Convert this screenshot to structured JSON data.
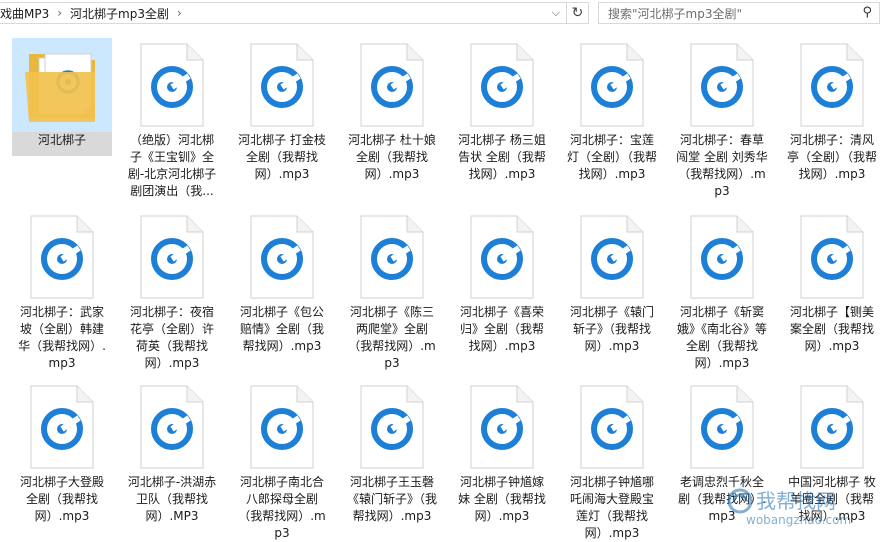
{
  "address_bar": {
    "segments": [
      "戏曲MP3",
      "河北梆子mp3全剧"
    ],
    "separator": "›"
  },
  "search": {
    "placeholder": "搜索\"河北梆子mp3全剧\""
  },
  "icons": {
    "folder": "folder-icon",
    "audio": "groove-music-file-icon",
    "refresh": "refresh-icon",
    "search": "search-icon",
    "dropdown": "chevron-down-icon"
  },
  "colors": {
    "audio_accent": "#1e7fd6",
    "folder_yellow": "#f2c14e",
    "selection": "#d9d9d9"
  },
  "files": [
    {
      "name": "河北梆子",
      "type": "folder",
      "selected": true
    },
    {
      "name": "（绝版）河北梆子《王宝钏》全剧-北京河北梆子剧团演出（我...",
      "type": "audio"
    },
    {
      "name": "河北梆子 打金枝 全剧（我帮找网）.mp3",
      "type": "audio"
    },
    {
      "name": "河北梆子 杜十娘 全剧（我帮找网）.mp3",
      "type": "audio"
    },
    {
      "name": "河北梆子 杨三姐 告状 全剧（我帮找网）.mp3",
      "type": "audio"
    },
    {
      "name": "河北梆子：宝莲灯（全剧）（我帮找网）.mp3",
      "type": "audio"
    },
    {
      "name": "河北梆子：春草闯堂 全剧 刘秀华（我帮找网）.mp3",
      "type": "audio"
    },
    {
      "name": "河北梆子：清风亭（全剧）（我帮找网）.mp3",
      "type": "audio"
    },
    {
      "name": "河北梆子：武家坡（全剧）韩建华（我帮找网）.mp3",
      "type": "audio"
    },
    {
      "name": "河北梆子：夜宿花亭（全剧）许荷英（我帮找网）.mp3",
      "type": "audio"
    },
    {
      "name": "河北梆子《包公赔情》全剧（我帮找网）.mp3",
      "type": "audio"
    },
    {
      "name": "河北梆子《陈三两爬堂》全剧（我帮找网）.mp3",
      "type": "audio"
    },
    {
      "name": "河北梆子《喜荣归》全剧（我帮找网）.mp3",
      "type": "audio"
    },
    {
      "name": "河北梆子《辕门斩子》（我帮找网）.mp3",
      "type": "audio"
    },
    {
      "name": "河北梆子《斩窦娥》《南北谷》等全剧（我帮找网）.mp3",
      "type": "audio"
    },
    {
      "name": "河北梆子【铡美案全剧（我帮找网）.mp3",
      "type": "audio"
    },
    {
      "name": "河北梆子大登殿全剧（我帮找网）.mp3",
      "type": "audio"
    },
    {
      "name": "河北梆子-洪湖赤卫队（我帮找网）.MP3",
      "type": "audio"
    },
    {
      "name": "河北梆子南北合八郎探母全剧（我帮找网）.mp3",
      "type": "audio"
    },
    {
      "name": "河北梆子王玉磬《辕门斩子》（我帮找网）.mp3",
      "type": "audio"
    },
    {
      "name": "河北梆子钟馗嫁妹 全剧（我帮找网）.mp3",
      "type": "audio"
    },
    {
      "name": "河北梆子钟馗哪吒闹海大登殿宝莲灯（我帮找网）.mp3",
      "type": "audio"
    },
    {
      "name": "老调忠烈千秋全剧（我帮找网）.mp3",
      "type": "audio"
    },
    {
      "name": "中国河北梆子 牧羊圈全剧（我帮找网）.mp3",
      "type": "audio"
    }
  ],
  "watermark": {
    "text": "wobangzhao.com",
    "logo_text": "我帮找网"
  }
}
